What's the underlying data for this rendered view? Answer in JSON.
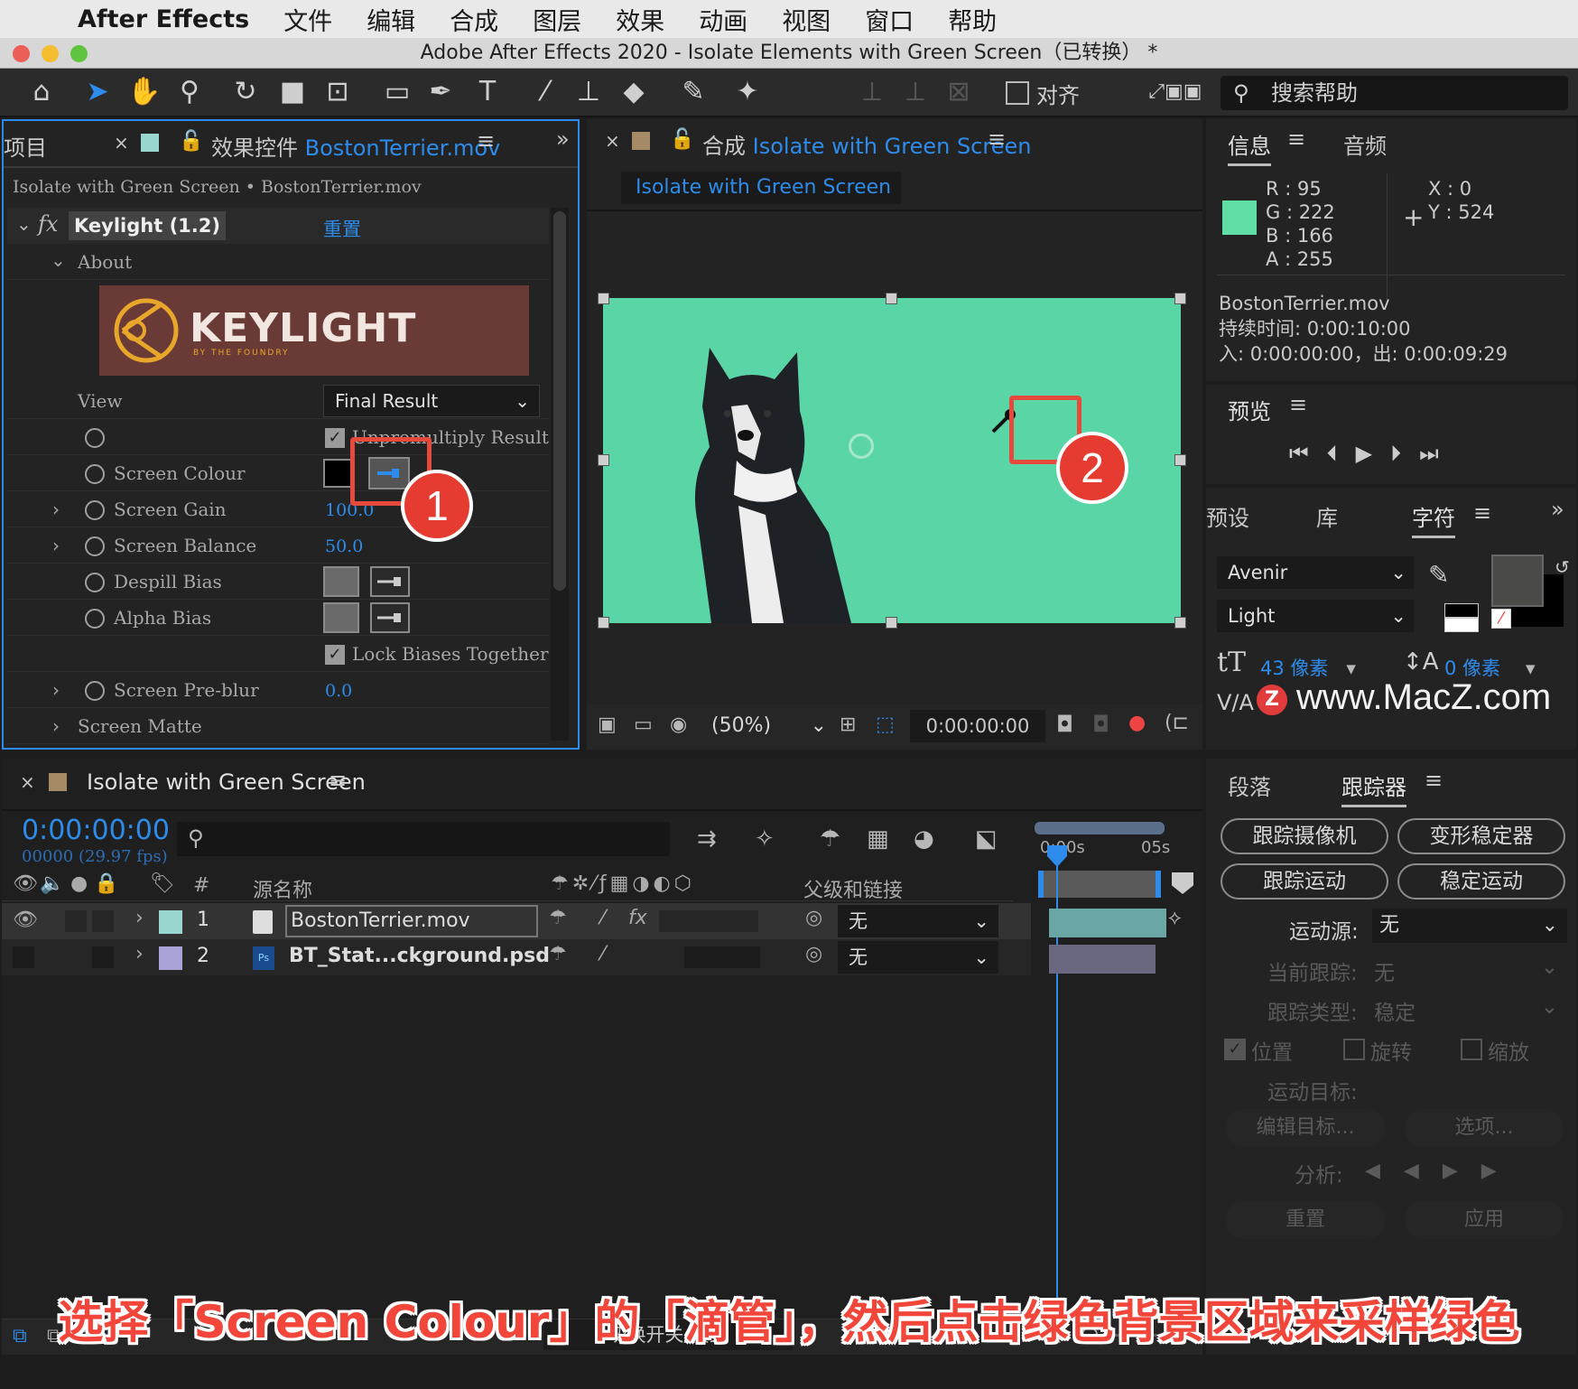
{
  "menubar": {
    "app": "After Effects",
    "items": [
      "文件",
      "编辑",
      "合成",
      "图层",
      "效果",
      "动画",
      "视图",
      "窗口",
      "帮助"
    ]
  },
  "window": {
    "title": "Adobe After Effects 2020 - Isolate Elements with Green Screen（已转换） *"
  },
  "toolbar": {
    "align_label": "对齐",
    "search_placeholder": "搜索帮助"
  },
  "effects_panel": {
    "tab_project": "项目",
    "tab_prefix": "效果控件",
    "tab_file": "BostonTerrier.mov",
    "breadcrumb": "Isolate with Green Screen • BostonTerrier.mov",
    "effect_name": "Keylight (1.2)",
    "reset": "重置",
    "about": "About",
    "logo_text": "KEYLIGHT",
    "logo_sub": "BY THE FOUNDRY",
    "view_label": "View",
    "view_value": "Final Result",
    "unpremultiply": "Unpremultiply Result",
    "screen_colour": "Screen Colour",
    "screen_gain": "Screen Gain",
    "screen_gain_value": "100.0",
    "screen_balance": "Screen Balance",
    "screen_balance_value": "50.0",
    "despill_bias": "Despill Bias",
    "alpha_bias": "Alpha Bias",
    "lock_biases": "Lock Biases Together",
    "screen_preblur": "Screen Pre-blur",
    "screen_preblur_value": "0.0",
    "screen_matte": "Screen Matte"
  },
  "comp_panel": {
    "tab_prefix": "合成",
    "tab_name": "Isolate with Green Screen",
    "comp_tab": "Isolate with Green Screen",
    "zoom": "(50%)",
    "timecode": "0:00:00:00",
    "bg_color": "#5ad6a6"
  },
  "info_panel": {
    "tab_info": "信息",
    "tab_audio": "音频",
    "r": "R :  95",
    "g": "G :  222",
    "b": "B :  166",
    "a": "A :  255",
    "x": "X : 0",
    "y": "Y : 524",
    "swatch": "#5fdea6",
    "file": "BostonTerrier.mov",
    "duration": "持续时间: 0:00:10:00",
    "inout": "入: 0:00:00:00，出: 0:00:09:29"
  },
  "preview_panel": {
    "title": "预览"
  },
  "char_panel": {
    "tab_presets": "预设",
    "tab_library": "库",
    "tab_char": "字符",
    "font": "Avenir",
    "style": "Light",
    "size": "43 像素",
    "leading": "0 像素",
    "watermark": "www.MacZ.com"
  },
  "timeline": {
    "tab": "Isolate with Green Screen",
    "timecode": "0:00:00:00",
    "frames": "00000 (29.97 fps)",
    "col_num": "#",
    "col_source": "源名称",
    "col_parent": "父级和链接",
    "ruler_start": "0:00s",
    "ruler_end": "05s",
    "layers": [
      {
        "num": "1",
        "name": "BostonTerrier.mov",
        "parent": "无",
        "color": "#9ad6d0"
      },
      {
        "num": "2",
        "name": "BT_Stat...ckground.psd",
        "parent": "无",
        "color": "#a8a2d6"
      }
    ],
    "bottom": "切换开关/模式"
  },
  "tracker": {
    "tab_para": "段落",
    "tab_tracker": "跟踪器",
    "b1": "跟踪摄像机",
    "b2": "变形稳定器",
    "b3": "跟踪运动",
    "b4": "稳定运动",
    "motion_source": "运动源:",
    "motion_source_value": "无",
    "current_track": "当前跟踪:",
    "current_track_value": "无",
    "track_type": "跟踪类型:",
    "track_type_value": "稳定",
    "cb_position": "位置",
    "cb_rotation": "旋转",
    "cb_scale": "缩放",
    "motion_target": "运动目标:",
    "edit_target": "编辑目标...",
    "options": "选项...",
    "analyze": "分析:",
    "reset": "重置",
    "apply": "应用"
  },
  "caption": "选择「Screen Colour」的「滴管」，然后点击绿色背景区域来采样绿色",
  "annotations": [
    "1",
    "2"
  ]
}
